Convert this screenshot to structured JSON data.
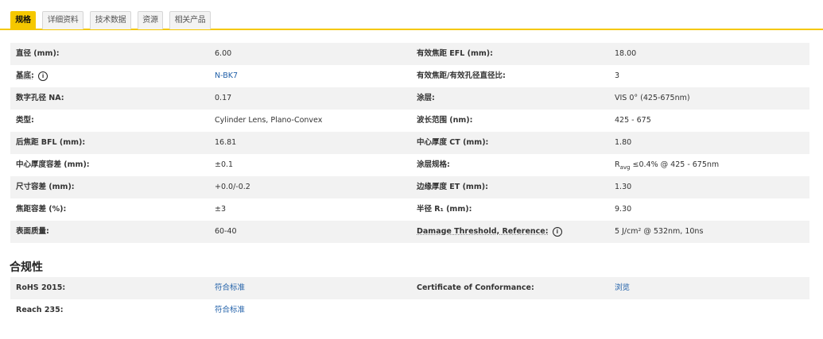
{
  "tabs": [
    {
      "label": "规格"
    },
    {
      "label": "详细资料"
    },
    {
      "label": "技术数据"
    },
    {
      "label": "资源"
    },
    {
      "label": "相关产品"
    }
  ],
  "specs": [
    {
      "l1": "直径 (mm):",
      "v1": "6.00",
      "l2": "有效焦距 EFL (mm):",
      "v2": "18.00"
    },
    {
      "l1": "基底:",
      "v1": "N-BK7",
      "l2": "有效焦距/有效孔径直径比:",
      "v2": "3"
    },
    {
      "l1": "数字孔径 NA:",
      "v1": "0.17",
      "l2": "涂层:",
      "v2": "VIS 0° (425-675nm)"
    },
    {
      "l1": "类型:",
      "v1": "Cylinder Lens, Plano-Convex",
      "l2": "波长范围 (nm):",
      "v2": "425 - 675"
    },
    {
      "l1": "后焦距 BFL (mm):",
      "v1": "16.81",
      "l2": "中心厚度 CT (mm):",
      "v2": "1.80"
    },
    {
      "l1": "中心厚度容差 (mm):",
      "v1": "±0.1",
      "l2": "涂层规格:",
      "v2_prefix": "R",
      "v2_sub": "avg",
      "v2": "≤0.4% @ 425 - 675nm"
    },
    {
      "l1": "尺寸容差 (mm):",
      "v1": "+0.0/-0.2",
      "l2": "边缘厚度 ET (mm):",
      "v2": "1.30"
    },
    {
      "l1": "焦距容差 (%):",
      "v1": "±3",
      "l2": "半径 R₁ (mm):",
      "v2": "9.30"
    },
    {
      "l1": "表面质量:",
      "v1": "60-40",
      "l2": "Damage Threshold, Reference:",
      "v2": "5 J/cm² @ 532nm, 10ns"
    }
  ],
  "info_icon_glyph": "i",
  "compliance": {
    "title": "合规性",
    "rows": [
      {
        "l1": "RoHS 2015:",
        "v1": "符合标准",
        "l2": "Certificate of Conformance:",
        "v2": "浏览"
      },
      {
        "l1": "Reach 235:",
        "v1": "符合标准",
        "l2": "",
        "v2": ""
      }
    ]
  }
}
